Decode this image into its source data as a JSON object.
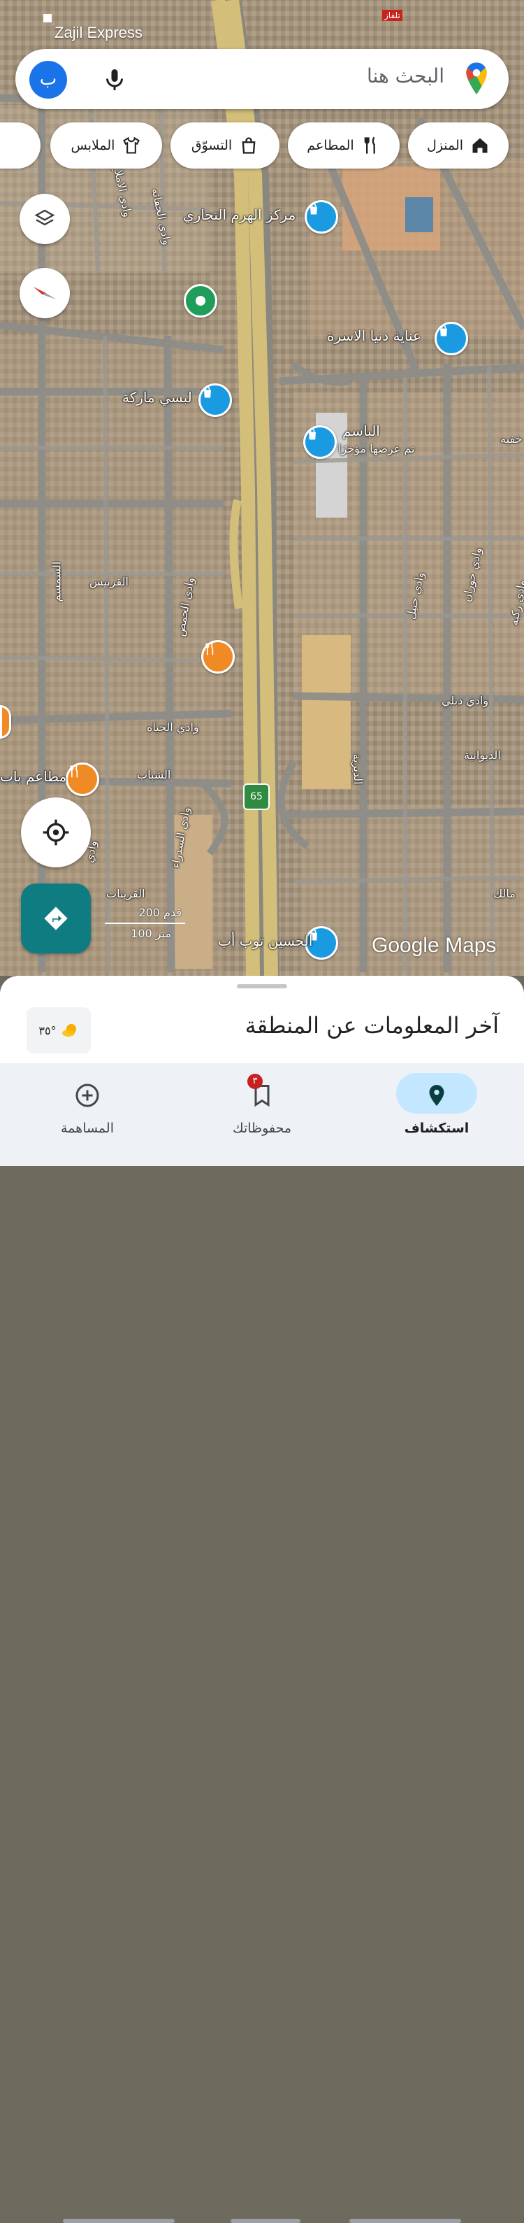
{
  "status_bar": {
    "carrier": "Zajil Express",
    "tv_badge": "تلفاز"
  },
  "search": {
    "avatar_letter": "ب",
    "placeholder": "البحث هنا"
  },
  "chips": [
    {
      "label": "المنزل",
      "icon": "home-icon"
    },
    {
      "label": "المطاعم",
      "icon": "fork-knife-icon"
    },
    {
      "label": "التسوّق",
      "icon": "shopping-bag-icon"
    },
    {
      "label": "الملابس",
      "icon": "shirt-icon"
    }
  ],
  "map": {
    "places": [
      {
        "name": "مركز الهرم التجاري",
        "type": "shopping"
      },
      {
        "name": "عناية دنيا الاسرة",
        "type": "shopping"
      },
      {
        "name": "لبسي ماركة",
        "type": "shopping"
      },
      {
        "name": "الباسم",
        "type": "shopping",
        "note": "تم عرضها مؤخرًا"
      },
      {
        "name": "مطاعم باب",
        "type": "restaurant"
      },
      {
        "name": "الحسين توب أب",
        "type": "shopping"
      }
    ],
    "streets": [
      "وادي الاملاح",
      "وادي الجفانه",
      "القرنيس",
      "السمسم",
      "وادي الحمض",
      "وادي الحياه",
      "الشباب",
      "وادي السدراء",
      "وادي",
      "القرينات",
      "وادي حنيل",
      "وادي حوران",
      "وادي ركبه",
      "وادي دبلي",
      "الديوانية",
      "الديرية",
      "خفيه",
      "مالك"
    ],
    "highway_shield": "65",
    "scale": {
      "upper": "200 قدم",
      "lower": "100 متر"
    },
    "watermark": "Google Maps"
  },
  "sheet": {
    "weather_temp": "٣٥°",
    "title": "آخر المعلومات عن المنطقة"
  },
  "nav": {
    "explore": "استكشاف",
    "saved": "محفوظاتك",
    "saved_badge": "٣",
    "contribute": "المساهمة"
  },
  "colors": {
    "primary": "#1a73e8",
    "teal": "#0f7c82",
    "active_pill": "#c2e7ff",
    "poi_blue": "#1a9ae0",
    "poi_orange": "#f08a24"
  }
}
